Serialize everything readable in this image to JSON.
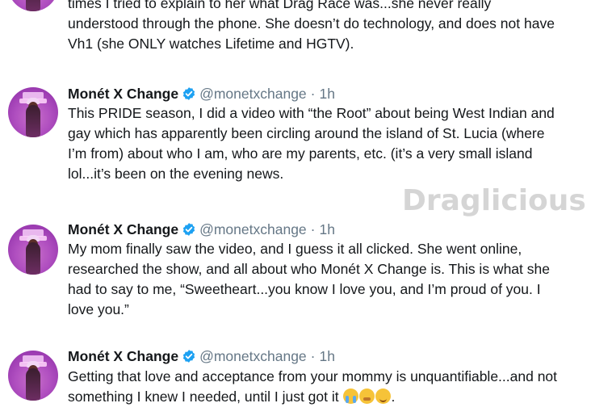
{
  "tweets": [
    {
      "text_lines": [
        "times I tried to explain to her what Drag Race was...she never really",
        "understood through the phone. She doesn’t do technology, and does not have",
        "Vh1 (she ONLY watches Lifetime and HGTV)."
      ]
    },
    {
      "name": "Monét X Change",
      "handle": "@monetxchange",
      "separator": "·",
      "time": "1h",
      "text_lines": [
        "This PRIDE season, I did a video with “the Root” about being West Indian and",
        "gay which has apparently been circling around the island of St. Lucia (where",
        "I’m from) about who I am, who are my parents, etc. (it’s a very small island",
        "lol...it’s been on the evening news."
      ]
    },
    {
      "name": "Monét X Change",
      "handle": "@monetxchange",
      "separator": "·",
      "time": "1h",
      "text_lines": [
        "My mom finally saw the video, and I guess it all clicked. She went online,",
        "researched the show, and all about who Monét X Change is. This is what she",
        "had to say to me, “Sweetheart...you know I love you, and I’m proud of you. I",
        "love you.”"
      ]
    },
    {
      "name": "Monét X Change",
      "handle": "@monetxchange",
      "separator": "·",
      "time": "1h",
      "text_lines": [
        "Getting that love and acceptance from your mommy is unquantifiable...and not",
        "something I knew I needed, until I just got it",
        "."
      ],
      "emojis": [
        "loudly-crying-face-icon",
        "tired-face-icon",
        "relieved-face-icon"
      ]
    }
  ],
  "watermark": "Draglicious",
  "colors": {
    "verified": "#1da1f2",
    "secondary_text": "#657786",
    "text": "#14171a"
  }
}
